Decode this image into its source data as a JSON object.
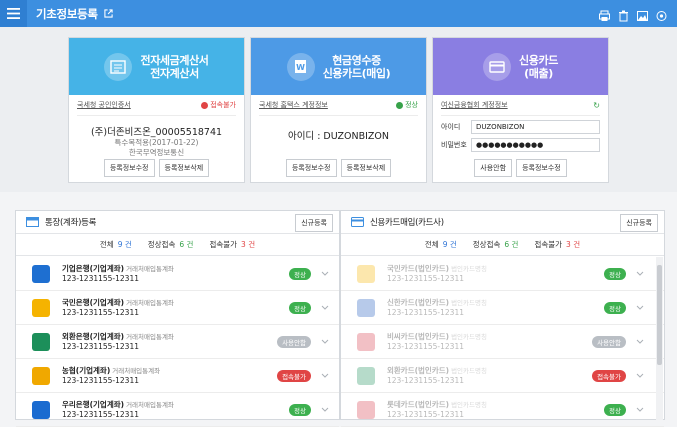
{
  "header": {
    "title": "기초정보등록"
  },
  "cards": [
    {
      "title_line1": "전자세금계산서",
      "title_line2": "전자계산서",
      "link": "국세청 공인인증서",
      "status": "접속불가",
      "main_text": "(주)더존비즈온_00005518741",
      "sub_text1": "특수목적용(2017-01-22)",
      "sub_text2": "한국무역정보통신",
      "btn1": "등록정보수정",
      "btn2": "등록정보삭제"
    },
    {
      "title_line1": "현금영수증",
      "title_line2": "신용카드(매입)",
      "link": "국세청 홈택스 계정정보",
      "status": "정상",
      "main_text": "아이디 : DUZONBIZON",
      "btn1": "등록정보수정",
      "btn2": "등록정보삭제"
    },
    {
      "title_line1": "신용카드",
      "title_line2": "(매출)",
      "link": "여신금융협회 계정정보",
      "id_label": "아이디",
      "id_value": "DUZONBIZON",
      "pw_label": "비밀번호",
      "pw_value": "●●●●●●●●●●●",
      "btn1": "사용안함",
      "btn2": "등록정보수정"
    }
  ],
  "panels": [
    {
      "title": "통장(계좌)등록",
      "new_button": "신규등록",
      "summary": {
        "total_label": "전체",
        "total": "9 건",
        "ok_label": "정상접속",
        "ok": "6 건",
        "bad_label": "접속불가",
        "bad": "3 건"
      },
      "rows": [
        {
          "name": "기업은행(기업계좌)",
          "sub": "거래처매입통계좌",
          "account": "123-1231155-12311",
          "status": "정상",
          "status_type": "ok",
          "logo_color": "#1e6fd1"
        },
        {
          "name": "국민은행(기업계좌)",
          "sub": "거래처매입통계좌",
          "account": "123-1231155-12311",
          "status": "정상",
          "status_type": "ok",
          "logo_color": "#f5b300"
        },
        {
          "name": "외환은행(기업계좌)",
          "sub": "거래처매입통계좌",
          "account": "123-1231155-12311",
          "status": "사용안함",
          "status_type": "off",
          "logo_color": "#1c8f5a"
        },
        {
          "name": "농협(기업계좌)",
          "sub": "거래처매입통계좌",
          "account": "123-1231155-12311",
          "status": "접속불가",
          "status_type": "bad",
          "logo_color": "#f0a800"
        },
        {
          "name": "우리은행(기업계좌)",
          "sub": "거래처매입통계좌",
          "account": "123-1231155-12311",
          "status": "정상",
          "status_type": "ok",
          "logo_color": "#1a6bd0"
        }
      ]
    },
    {
      "title": "신용카드매입(카드사)",
      "new_button": "신규등록",
      "summary": {
        "total_label": "전체",
        "total": "9 건",
        "ok_label": "정상접속",
        "ok": "6 건",
        "bad_label": "접속불가",
        "bad": "3 건"
      },
      "rows": [
        {
          "name": "국민카드(법인카드)",
          "sub": "법인카드명칭",
          "account": "123-1231155-12311",
          "status": "정상",
          "status_type": "ok",
          "logo_color": "#f5b300"
        },
        {
          "name": "신한카드(법인카드)",
          "sub": "법인카드명칭",
          "account": "123-1231155-12311",
          "status": "정상",
          "status_type": "ok",
          "logo_color": "#1e5bbf"
        },
        {
          "name": "비씨카드(법인카드)",
          "sub": "법인카드명칭",
          "account": "123-1231155-12311",
          "status": "사용안함",
          "status_type": "off",
          "logo_color": "#d63a4a"
        },
        {
          "name": "외환카드(법인카드)",
          "sub": "법인카드명칭",
          "account": "123-1231155-12311",
          "status": "접속불가",
          "status_type": "bad",
          "logo_color": "#1c8f5a"
        },
        {
          "name": "롯데카드(법인카드)",
          "sub": "법인카드명칭",
          "account": "123-1231155-12311",
          "status": "정상",
          "status_type": "ok",
          "logo_color": "#d63a4a"
        }
      ]
    }
  ]
}
